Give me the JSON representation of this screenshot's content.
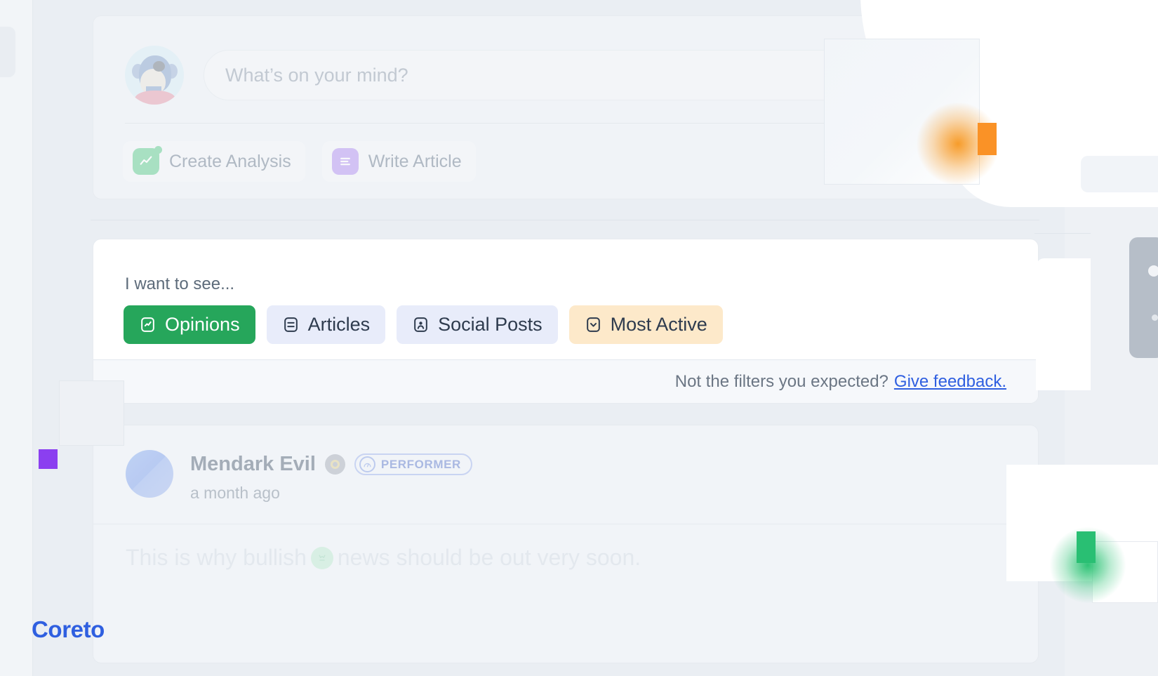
{
  "brand": {
    "name": "Coreto",
    "color": "#2f5fe0"
  },
  "composer": {
    "avatar_alt": "ape-avatar",
    "input_placeholder": "What’s on your mind?",
    "input_value": "",
    "actions": [
      {
        "label": "Create Analysis",
        "icon": "chart-line-icon",
        "color": "#8fdcb0"
      },
      {
        "label": "Write Article",
        "icon": "article-lines-icon",
        "color": "#c9b2f5"
      }
    ]
  },
  "filters": {
    "title": "I want to see...",
    "chips": [
      {
        "label": "Opinions",
        "icon": "opinion-check-icon",
        "state": "selected",
        "bg": "#26a65b",
        "fg": "#ffffff"
      },
      {
        "label": "Articles",
        "icon": "article-icon",
        "state": "default",
        "bg": "#e8ecfa",
        "fg": "#2e3b4e"
      },
      {
        "label": "Social Posts",
        "icon": "social-person-icon",
        "state": "default",
        "bg": "#e8ecfa",
        "fg": "#2e3b4e"
      },
      {
        "label": "Most Active",
        "icon": "most-active-icon",
        "state": "highlighted",
        "bg": "#fde9ca",
        "fg": "#2e3b4e"
      }
    ],
    "feedback_prompt": "Not the filters you expected?",
    "feedback_link": "Give feedback."
  },
  "post": {
    "author": "Mendark Evil",
    "rank_icon": "medal-icon",
    "badge": "PERFORMER",
    "badge_icon": "performer-gauge-icon",
    "timestamp": "a month ago",
    "body_before": "This is why bullish",
    "body_token_icon": "coin-icon",
    "body_after": "news should be out very soon."
  },
  "decor": {
    "orange": "#fa9226",
    "green": "#29bf73",
    "purple": "#8b3ff0"
  }
}
